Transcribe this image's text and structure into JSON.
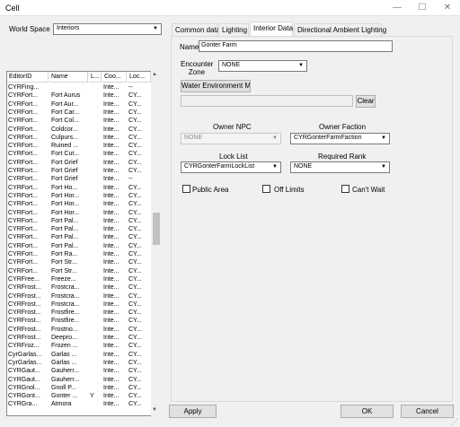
{
  "window": {
    "title": "Cell",
    "minimize": "—",
    "maximize": "☐",
    "close": "✕"
  },
  "world_space": {
    "label": "World Space",
    "value": "Interiors"
  },
  "list": {
    "columns": [
      "EditorID",
      "Name",
      "L...",
      "Coo...",
      "Loc..."
    ],
    "rows": [
      [
        "CYRFing...",
        "",
        "",
        "Inte...",
        "--"
      ],
      [
        "CYRFort...",
        "Fort Aurus",
        "",
        "Inte...",
        "CY..."
      ],
      [
        "CYRFort...",
        "Fort Aur...",
        "",
        "Inte...",
        "CY..."
      ],
      [
        "CYRFort...",
        "Fort Car...",
        "",
        "Inte...",
        "CY..."
      ],
      [
        "CYRFort...",
        "Fort Col...",
        "",
        "Inte...",
        "CY..."
      ],
      [
        "CYRFort...",
        "Coldcor...",
        "",
        "Inte...",
        "CY..."
      ],
      [
        "CYRFort...",
        "Culpurs...",
        "",
        "Inte...",
        "CY..."
      ],
      [
        "CYRFort...",
        "Ruined ...",
        "",
        "Inte...",
        "CY..."
      ],
      [
        "CYRFort...",
        "Fort Cut...",
        "",
        "Inte...",
        "CY..."
      ],
      [
        "CYRFort...",
        "Fort Grief",
        "",
        "Inte...",
        "CY..."
      ],
      [
        "CYRFort...",
        "Fort Grief",
        "",
        "Inte...",
        "CY..."
      ],
      [
        "CYRFort...",
        "Fort Grief",
        "",
        "Inte...",
        "--"
      ],
      [
        "CYRFort...",
        "Fort Ho...",
        "",
        "Inte...",
        "CY..."
      ],
      [
        "CYRFort...",
        "Fort Hor...",
        "",
        "Inte...",
        "CY..."
      ],
      [
        "CYRFort...",
        "Fort Hor...",
        "",
        "Inte...",
        "CY..."
      ],
      [
        "CYRFort...",
        "Fort Hor...",
        "",
        "Inte...",
        "CY..."
      ],
      [
        "CYRFort...",
        "Fort Pal...",
        "",
        "Inte...",
        "CY..."
      ],
      [
        "CYRFort...",
        "Fort Pal...",
        "",
        "Inte...",
        "CY..."
      ],
      [
        "CYRFort...",
        "Fort Pal...",
        "",
        "Inte...",
        "CY..."
      ],
      [
        "CYRFort...",
        "Fort Pal...",
        "",
        "Inte...",
        "CY..."
      ],
      [
        "CYRFort...",
        "Fort Ra...",
        "",
        "Inte...",
        "CY..."
      ],
      [
        "CYRFort...",
        "Fort Str...",
        "",
        "Inte...",
        "CY..."
      ],
      [
        "CYRFort...",
        "Fort Str...",
        "",
        "Inte...",
        "CY..."
      ],
      [
        "CYRFree...",
        "Freeze...",
        "",
        "Inte...",
        "CY..."
      ],
      [
        "CYRFrost...",
        "Frostcra...",
        "",
        "Inte...",
        "CY..."
      ],
      [
        "CYRFrost...",
        "Frostcra...",
        "",
        "Inte...",
        "CY..."
      ],
      [
        "CYRFrost...",
        "Frostcra...",
        "",
        "Inte...",
        "CY..."
      ],
      [
        "CYRFrost...",
        "Frostfire...",
        "",
        "Inte...",
        "CY..."
      ],
      [
        "CYRFrost...",
        "Frostfire...",
        "",
        "Inte...",
        "CY..."
      ],
      [
        "CYRFrost...",
        "Frostno...",
        "",
        "Inte...",
        "CY..."
      ],
      [
        "CYRFrost...",
        "Deepro...",
        "",
        "Inte...",
        "CY..."
      ],
      [
        "CYRFroz...",
        "Frozen ...",
        "",
        "Inte...",
        "CY..."
      ],
      [
        "CyrGarlas...",
        "Garlas ...",
        "",
        "Inte...",
        "CY..."
      ],
      [
        "CyrGarlas...",
        "Garlas ...",
        "",
        "Inte...",
        "CY..."
      ],
      [
        "CYRGaut...",
        "Gauherr...",
        "",
        "Inte...",
        "CY..."
      ],
      [
        "CYRGaut...",
        "Gauherr...",
        "",
        "Inte...",
        "CY..."
      ],
      [
        "CYRGnol...",
        "Gnoll P...",
        "",
        "Inte...",
        "CY..."
      ],
      [
        "CYRGont...",
        "Gonter ...",
        "Y",
        "Inte...",
        "CY..."
      ],
      [
        "CYRGra...",
        "Atmora",
        "",
        "Inte...",
        "CY..."
      ]
    ]
  },
  "tabs": [
    "Common data",
    "Lighting",
    "Interior Data",
    "Directional Ambient Lighting"
  ],
  "active_tab": "Interior Data",
  "form": {
    "name_label": "Name",
    "name_value": "Gonter Farm",
    "encounter_label": "Encounter Zone",
    "encounter_value": "NONE",
    "water_button": "Water Environment Ma",
    "water_value": "",
    "clear_button": "Clear",
    "owner_npc_label": "Owner NPC",
    "owner_npc_value": "NONE",
    "owner_faction_label": "Owner Faction",
    "owner_faction_value": "CYRGonterFarmFaction",
    "lock_list_label": "Lock List",
    "lock_list_value": "CYRGonterFarmLockList",
    "required_rank_label": "Required Rank",
    "required_rank_value": "NONE",
    "public_area_label": "Public Area",
    "off_limits_label": "Off Limits",
    "cant_wait_label": "Can't Wait"
  },
  "buttons": {
    "apply": "Apply",
    "ok": "OK",
    "cancel": "Cancel"
  },
  "scroll": {
    "position": 0.45,
    "thumb_fraction": 0.1
  }
}
